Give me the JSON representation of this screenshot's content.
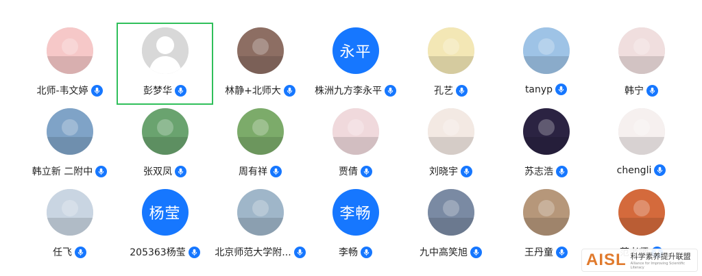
{
  "participants": [
    {
      "name": "北师-韦文婷",
      "avatar": "cartoon-pig-image",
      "bg": "#f6c8c8"
    },
    {
      "name": "彭梦华",
      "avatar": "default-person-icon",
      "bg": "#dcdcdc",
      "selected": true
    },
    {
      "name": "林静+北师大",
      "avatar": "woman-photo",
      "bg": "#8d6e63"
    },
    {
      "name": "株洲九方李永平",
      "avatar_text": "永平",
      "bg": "#1677ff"
    },
    {
      "name": "孔艺",
      "avatar": "cartoon-boy-image",
      "bg": "#f3e7b5"
    },
    {
      "name": "tanyp",
      "avatar": "city-photo",
      "bg": "#9ec3e6"
    },
    {
      "name": "韩宁",
      "avatar": "painted-girl-image",
      "bg": "#f0dede"
    },
    {
      "name": "韩立新 二附中",
      "avatar": "bridge-photo",
      "bg": "#7fa3c7"
    },
    {
      "name": "张双凤",
      "avatar": "family-photo",
      "bg": "#6aa36f"
    },
    {
      "name": "周有祥",
      "avatar": "plant-photo",
      "bg": "#7cab6a"
    },
    {
      "name": "贾倩",
      "avatar": "flower-photo",
      "bg": "#f0d9dc"
    },
    {
      "name": "刘晓宇",
      "avatar": "cartoon-cat-image",
      "bg": "#f3e9e3"
    },
    {
      "name": "苏志浩",
      "avatar": "night-sky-photo",
      "bg": "#2b2342"
    },
    {
      "name": "chengli",
      "avatar": "papercut-image",
      "bg": "#f6f0ef"
    },
    {
      "name": "任飞",
      "avatar": "child-photo",
      "bg": "#c9d5e2"
    },
    {
      "name": "205363杨莹",
      "avatar_text": "杨莹",
      "bg": "#1677ff"
    },
    {
      "name": "北京师范大学附...",
      "avatar": "lake-photo",
      "bg": "#9fb6c9"
    },
    {
      "name": "李畅",
      "avatar_text": "李畅",
      "bg": "#1677ff"
    },
    {
      "name": "九中高笑旭",
      "avatar": "car-interior-photo",
      "bg": "#7a8aa3"
    },
    {
      "name": "王丹童",
      "avatar": "room-photo",
      "bg": "#b6977a"
    },
    {
      "name": "范老师",
      "avatar": "red-leaves-photo",
      "bg": "#d46a3c"
    }
  ],
  "watermark": {
    "mark": "AISL",
    "cn": "科学素养提升联盟",
    "en": "Alliance for Improving Scientific Literacy"
  }
}
